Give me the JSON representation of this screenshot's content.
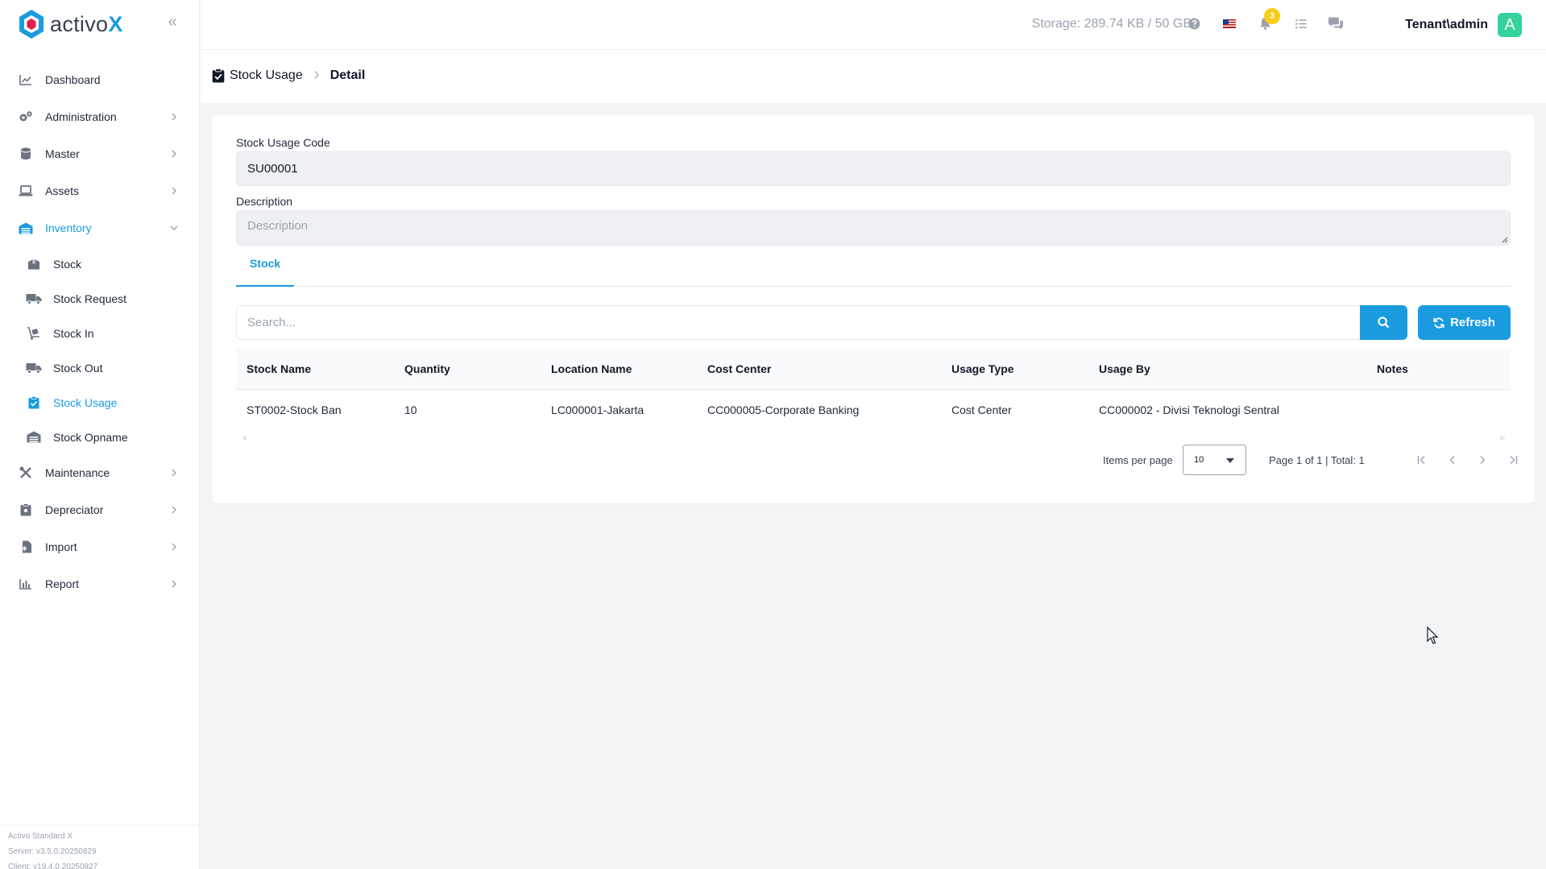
{
  "app": {
    "logo_text": "activo",
    "logo_accent": "X",
    "brand_color": "#1a9be0"
  },
  "sidebar": {
    "items": [
      {
        "label": "Dashboard",
        "icon": "chart-line-icon"
      },
      {
        "label": "Administration",
        "icon": "gears-icon"
      },
      {
        "label": "Master",
        "icon": "database-icon"
      },
      {
        "label": "Assets",
        "icon": "laptop-icon"
      },
      {
        "label": "Inventory",
        "icon": "warehouse-icon"
      },
      {
        "label": "Maintenance",
        "icon": "tools-icon"
      },
      {
        "label": "Depreciator",
        "icon": "clipboard-icon"
      },
      {
        "label": "Import",
        "icon": "file-import-icon"
      },
      {
        "label": "Report",
        "icon": "bar-chart-icon"
      }
    ],
    "inventory_sub": [
      {
        "label": "Stock",
        "icon": "box-icon"
      },
      {
        "label": "Stock Request",
        "icon": "truck-icon"
      },
      {
        "label": "Stock In",
        "icon": "dolly-icon"
      },
      {
        "label": "Stock Out",
        "icon": "truck-outgoing-icon"
      },
      {
        "label": "Stock Usage",
        "icon": "clipboard-check-icon"
      },
      {
        "label": "Stock Opname",
        "icon": "warehouse-icon"
      }
    ],
    "version": {
      "product": "Activo Standard X",
      "server": "Server: v3.5.0.20250829",
      "client": "Client: v19.4.0.20250827"
    }
  },
  "header": {
    "storage": "Storage: 289.74 KB / 50 GB",
    "notification_count": "3",
    "user": "Tenant\\admin",
    "avatar_letter": "A"
  },
  "breadcrumb": {
    "parent": "Stock Usage",
    "current": "Detail"
  },
  "form": {
    "code_label": "Stock Usage Code",
    "code_value": "SU00001",
    "description_label": "Description",
    "description_placeholder": "Description"
  },
  "tabs": [
    {
      "label": "Stock",
      "active": true
    }
  ],
  "search": {
    "placeholder": "Search...",
    "refresh_label": "Refresh"
  },
  "table": {
    "columns": [
      "Stock Name",
      "Quantity",
      "Location Name",
      "Cost Center",
      "Usage Type",
      "Usage By",
      "Notes"
    ],
    "rows": [
      [
        "ST0002-Stock Ban",
        "10",
        "LC000001-Jakarta",
        "CC000005-Corporate Banking",
        "Cost Center",
        "CC000002 - Divisi Teknologi Sentral",
        ""
      ]
    ]
  },
  "pagination": {
    "items_per_page_label": "Items per page",
    "items_per_page": "10",
    "page_info": "Page 1 of 1 | Total: 1"
  }
}
